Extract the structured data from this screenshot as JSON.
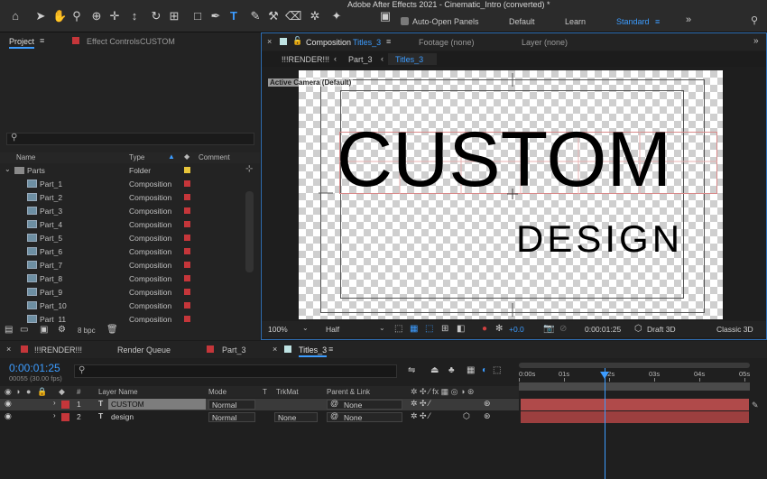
{
  "window": {
    "title": "Adobe After Effects 2021 - Cinematic_Intro (converted) *"
  },
  "toolbar": {
    "auto_open_label": "Auto-Open Panels",
    "auto_open_checked": true,
    "workspaces": [
      "Default",
      "Learn",
      "Standard"
    ],
    "active_workspace": "Standard"
  },
  "project_panel": {
    "tab_label": "Project",
    "effect_controls_label": "Effect Controls",
    "effect_controls_target": "CUSTOM",
    "columns": {
      "name": "Name",
      "type": "Type",
      "comment": "Comment"
    },
    "folder": {
      "name": "Parts",
      "type": "Folder"
    },
    "items": [
      {
        "name": "Part_1",
        "type": "Composition"
      },
      {
        "name": "Part_2",
        "type": "Composition"
      },
      {
        "name": "Part_3",
        "type": "Composition"
      },
      {
        "name": "Part_4",
        "type": "Composition"
      },
      {
        "name": "Part_5",
        "type": "Composition"
      },
      {
        "name": "Part_6",
        "type": "Composition"
      },
      {
        "name": "Part_7",
        "type": "Composition"
      },
      {
        "name": "Part_8",
        "type": "Composition"
      },
      {
        "name": "Part_9",
        "type": "Composition"
      },
      {
        "name": "Part_10",
        "type": "Composition"
      },
      {
        "name": "Part_11",
        "type": "Composition"
      }
    ],
    "bpc": "8 bpc"
  },
  "comp_panel": {
    "tab_prefix": "Composition",
    "tab_comp": "Titles_3",
    "footage_label": "Footage (none)",
    "layer_label": "Layer (none)",
    "breadcrumbs": [
      "!!!RENDER!!!",
      "Part_3",
      "Titles_3"
    ],
    "camera_label": "Active Camera (Default)",
    "text_main": "CUSTOM",
    "text_sub": "DESIGN",
    "footer": {
      "zoom": "100%",
      "resolution": "Half",
      "exposure": "+0.0",
      "timecode": "0:00:01:25",
      "renderer_mode": "Draft 3D",
      "renderer": "Classic 3D"
    }
  },
  "timeline": {
    "tabs": [
      "!!!RENDER!!!",
      "Render Queue",
      "Part_3",
      "Titles_3"
    ],
    "timecode": "0:00:01:25",
    "frame_info": "00055 (30.00 fps)",
    "columns": {
      "num": "#",
      "layer_name": "Layer Name",
      "mode": "Mode",
      "t": "T",
      "trkmat": "TrkMat",
      "parent": "Parent & Link"
    },
    "ruler": [
      "0:00s",
      "01s",
      "02s",
      "03s",
      "04s",
      "05s"
    ],
    "layers": [
      {
        "num": "1",
        "name": "CUSTOM",
        "mode": "Normal",
        "trkmat": "",
        "parent": "None",
        "selected": true
      },
      {
        "num": "2",
        "name": "design",
        "mode": "Normal",
        "trkmat": "None",
        "parent": "None",
        "selected": false
      }
    ],
    "playhead_fraction": 0.38
  },
  "colors": {
    "accent": "#2d8ceb",
    "label_red": "#c5363a",
    "bar_red": "#b04a4a",
    "label_yellow": "#e8c53a"
  }
}
